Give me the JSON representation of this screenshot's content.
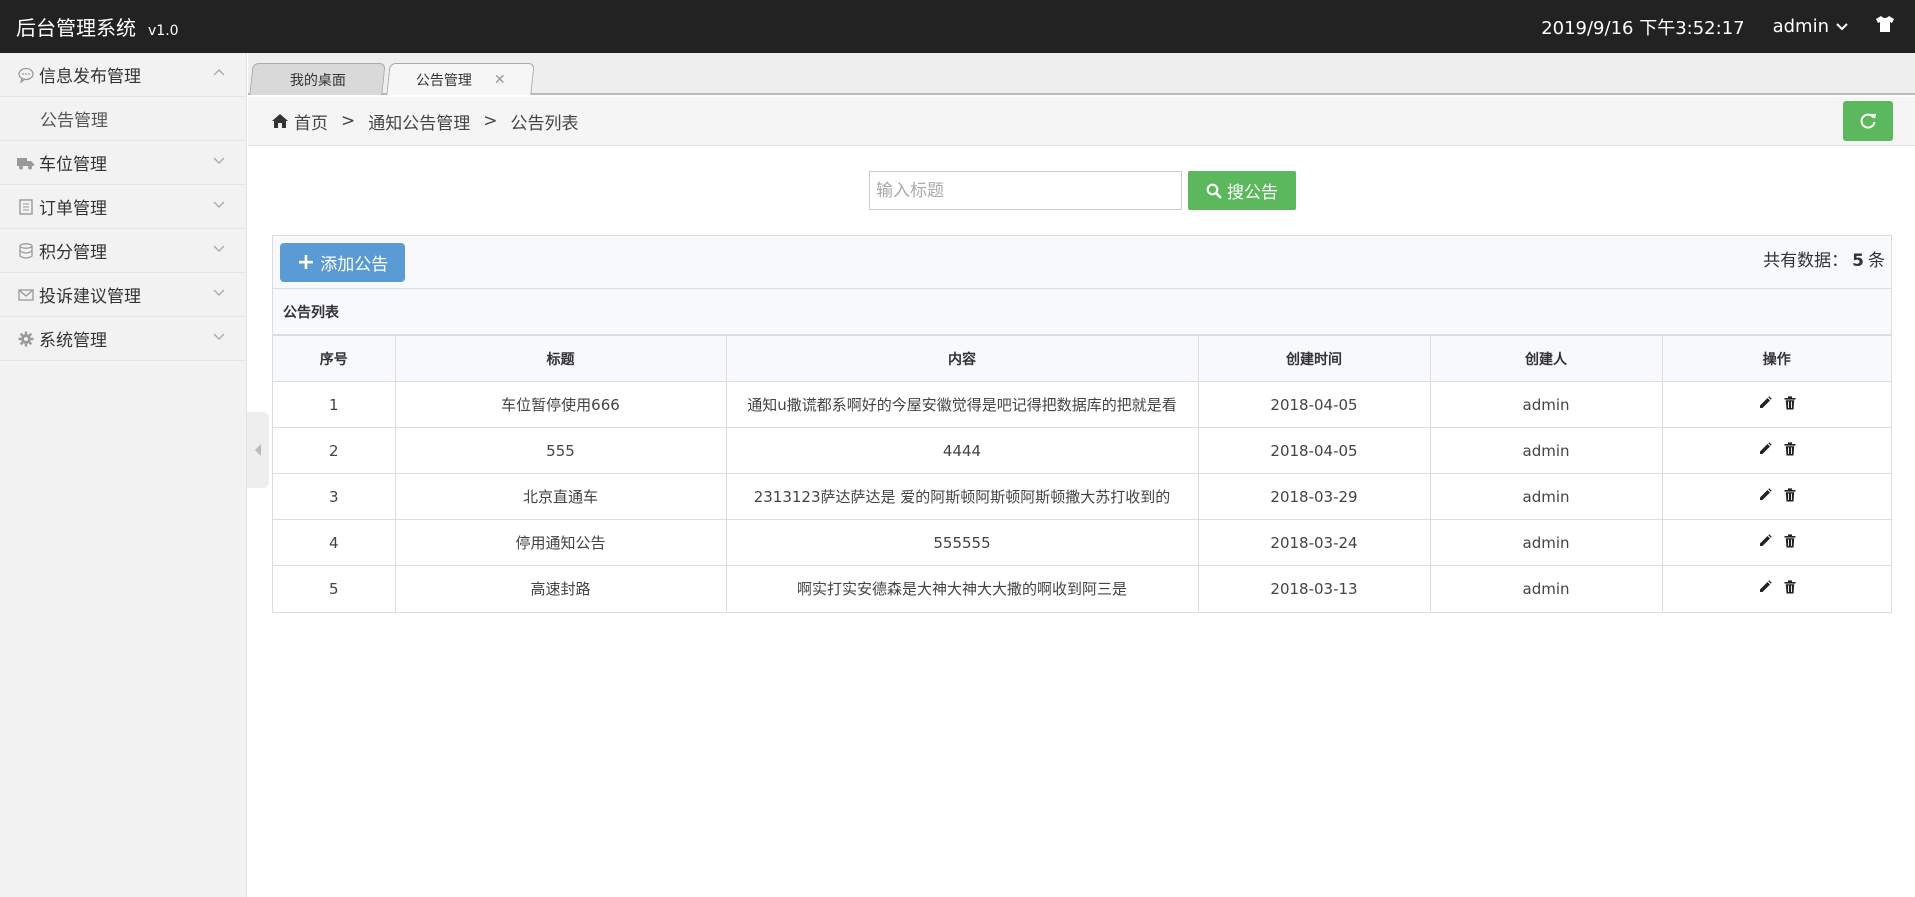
{
  "header": {
    "title": "后台管理系统",
    "version": "v1.0",
    "datetime": "2019/9/16 下午3:52:17",
    "user": "admin"
  },
  "sidebar": {
    "items": [
      {
        "label": "信息发布管理",
        "icon": "chat-icon",
        "expanded": true
      },
      {
        "label": "车位管理",
        "icon": "truck-icon",
        "expanded": false
      },
      {
        "label": "订单管理",
        "icon": "document-icon",
        "expanded": false
      },
      {
        "label": "积分管理",
        "icon": "database-icon",
        "expanded": false
      },
      {
        "label": "投诉建议管理",
        "icon": "envelope-icon",
        "expanded": false
      },
      {
        "label": "系统管理",
        "icon": "gear-icon",
        "expanded": false
      }
    ],
    "subitem": "公告管理"
  },
  "tabs": [
    {
      "label": "我的桌面"
    },
    {
      "label": "公告管理",
      "active": true
    }
  ],
  "breadcrumb": {
    "home": "首页",
    "sep": ">",
    "level1": "通知公告管理",
    "level2": "公告列表"
  },
  "search": {
    "placeholder": "输入标题",
    "button": "搜公告"
  },
  "toolbar": {
    "add_label": "添加公告",
    "total_prefix": "共有数据：",
    "total_count": "5",
    "total_suffix": "条"
  },
  "table": {
    "caption": "公告列表",
    "columns": [
      "序号",
      "标题",
      "内容",
      "创建时间",
      "创建人",
      "操作"
    ],
    "rows": [
      [
        "1",
        "车位暂停使用666",
        "通知u撒谎都系啊好的今屋安徽觉得是吧记得把数据库的把就是看",
        "2018-04-05",
        "admin"
      ],
      [
        "2",
        "555",
        "4444",
        "2018-04-05",
        "admin"
      ],
      [
        "3",
        "北京直通车",
        "2313123萨达萨达是 爱的阿斯顿阿斯顿阿斯顿撒大苏打收到的",
        "2018-03-29",
        "admin"
      ],
      [
        "4",
        "停用通知公告",
        "555555",
        "2018-03-24",
        "admin"
      ],
      [
        "5",
        "高速封路",
        "啊实打实安德森是大神大神大大撒的啊收到阿三是",
        "2018-03-13",
        "admin"
      ]
    ]
  },
  "colors": {
    "topbar": "#222222",
    "green": "#5cb85c",
    "blue": "#5b9bd5"
  }
}
